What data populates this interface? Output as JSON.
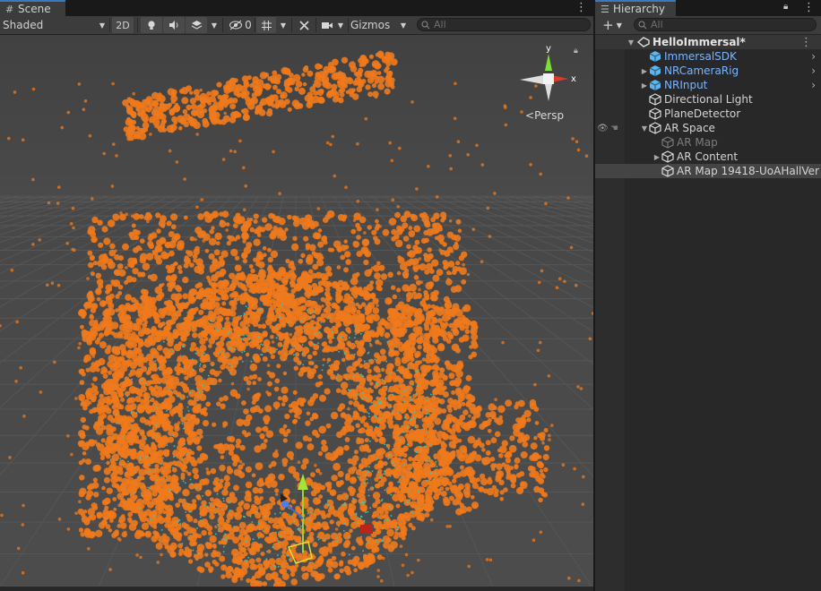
{
  "scene_tab": {
    "title": "Scene"
  },
  "scene_toolbar": {
    "shading_mode": "Shaded",
    "mode_2d": "2D",
    "hidden_count": "0",
    "gizmos_label": "Gizmos",
    "search_placeholder": "All"
  },
  "view_gizmo": {
    "x_label": "x",
    "y_label": "y",
    "projection_label": "Persp"
  },
  "hierarchy_tab": {
    "title": "Hierarchy"
  },
  "hierarchy_toolbar": {
    "add_label": "+",
    "search_placeholder": "All"
  },
  "hierarchy": {
    "scene_name": "HelloImmersal*",
    "items": [
      {
        "label": "ImmersalSDK",
        "indent": 0,
        "prefab": true,
        "foldout": false,
        "chevron": true,
        "disabled": false
      },
      {
        "label": "NRCameraRig",
        "indent": 0,
        "prefab": true,
        "foldout": true,
        "chevron": true,
        "disabled": false
      },
      {
        "label": "NRInput",
        "indent": 0,
        "prefab": true,
        "foldout": true,
        "chevron": true,
        "disabled": false
      },
      {
        "label": "Directional Light",
        "indent": 0,
        "prefab": false,
        "foldout": false,
        "chevron": false,
        "disabled": false
      },
      {
        "label": "PlaneDetector",
        "indent": 0,
        "prefab": false,
        "foldout": false,
        "chevron": false,
        "disabled": false
      },
      {
        "label": "AR Space",
        "indent": 0,
        "prefab": false,
        "foldout": true,
        "expanded": true,
        "chevron": false,
        "disabled": false,
        "visibility_icons": true
      },
      {
        "label": "AR Map",
        "indent": 1,
        "prefab": false,
        "foldout": false,
        "chevron": false,
        "disabled": true
      },
      {
        "label": "AR Content",
        "indent": 1,
        "prefab": false,
        "foldout": true,
        "chevron": false,
        "disabled": false
      },
      {
        "label": "AR Map 19418-UoAHallVer",
        "indent": 1,
        "prefab": false,
        "foldout": false,
        "chevron": false,
        "disabled": false,
        "selected": true
      }
    ]
  },
  "colors": {
    "point_cloud": "#f07a1c",
    "prefab_text": "#7cb4ff",
    "selection": "#444444",
    "accent": "#3a79bb"
  }
}
